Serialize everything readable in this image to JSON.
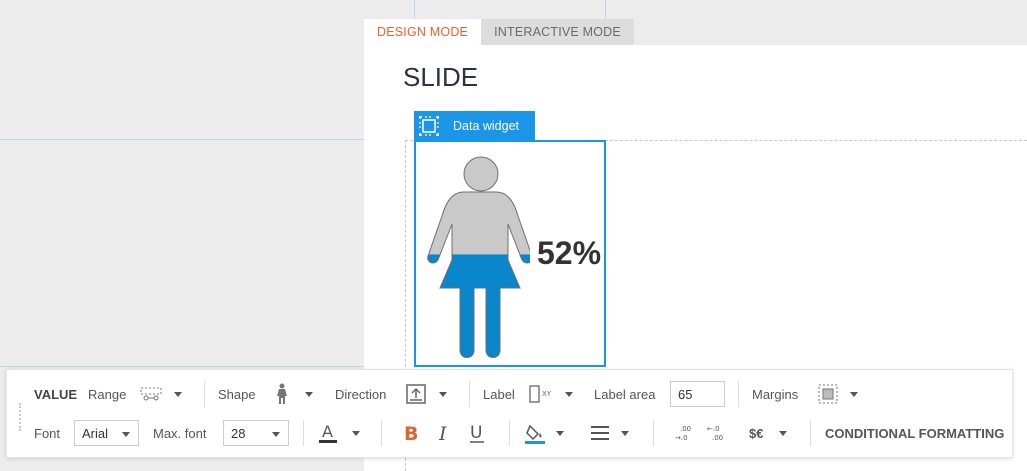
{
  "tabs": [
    {
      "label": "DESIGN MODE",
      "active": true
    },
    {
      "label": "INTERACTIVE MODE",
      "active": false
    }
  ],
  "slide": {
    "title": "SLIDE"
  },
  "widget": {
    "tag_label": "Data widget",
    "value": 0.52,
    "value_text": "52%",
    "shape": "person-female-icon",
    "fill_color": "#0a87cc",
    "empty_color": "#c9c9c9"
  },
  "toolbar": {
    "value_heading": "VALUE",
    "range_label": "Range",
    "shape_label": "Shape",
    "direction_label": "Direction",
    "label_label": "Label",
    "label_area_label": "Label area",
    "label_area_value": "65",
    "margins_label": "Margins",
    "font_label": "Font",
    "font_value": "Arial",
    "max_font_label": "Max. font",
    "max_font_value": "28",
    "currency_label": "$€",
    "conditional_formatting_label": "CONDITIONAL FORMATTING",
    "accent_color": "#1a95e8",
    "bold_color": "#e2622f"
  }
}
